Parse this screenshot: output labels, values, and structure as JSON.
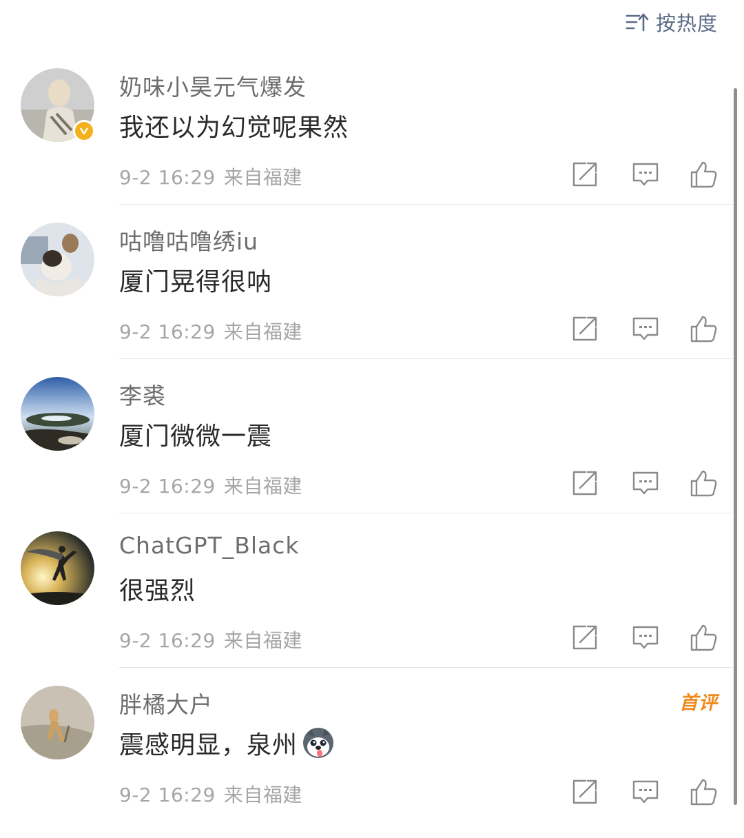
{
  "sort": {
    "label": "按热度",
    "icon": "sort-icon"
  },
  "comments": [
    {
      "username": "奶味小昊元气爆发",
      "text": "我还以为幻觉呢果然",
      "date": "9-2 16:29",
      "location": "来自福建",
      "verified": true
    },
    {
      "username": "咕噜咕噜绣iu",
      "text": "厦门晃得很呐",
      "date": "9-2 16:29",
      "location": "来自福建"
    },
    {
      "username": "李裘",
      "text": "厦门微微一震",
      "date": "9-2 16:29",
      "location": "来自福建"
    },
    {
      "username": "ChatGPT_Black",
      "text": "很强烈",
      "date": "9-2 16:29",
      "location": "来自福建"
    },
    {
      "username": "胖橘大户",
      "text": "震感明显，泉州",
      "date": "9-2 16:29",
      "location": "来自福建",
      "badge": "首评",
      "emoji": "husky-emoji"
    }
  ],
  "icons": {
    "share": "share-icon",
    "reply": "comment-icon",
    "like": "thumbs-up-icon"
  },
  "colors": {
    "accent": "#5b6b86",
    "badge": "#f08a1c",
    "verified": "#f5b01e",
    "meta": "#a6a6a6"
  }
}
